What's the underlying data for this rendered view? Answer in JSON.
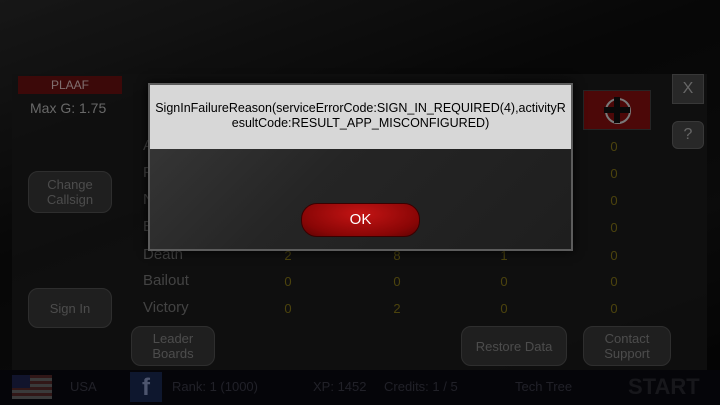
{
  "faction": "PLAAF",
  "max_g": "Max G: 1.75",
  "buttons": {
    "close": "X",
    "help": "?",
    "change_callsign": "Change Callsign",
    "sign_in": "Sign In",
    "leader_boards": "Leader Boards",
    "restore_data": "Restore Data",
    "contact_support": "Contact Support",
    "start": "START",
    "tech_tree": "Tech Tree"
  },
  "stats": {
    "partial_rows": [
      "A",
      "F",
      "N",
      "E"
    ],
    "rows": [
      {
        "label": "Death",
        "values": [
          "2",
          "8",
          "1"
        ]
      },
      {
        "label": "Bailout",
        "values": [
          "0",
          "0",
          "0"
        ]
      },
      {
        "label": "Victory",
        "values": [
          "0",
          "2",
          "0"
        ]
      }
    ],
    "right_column": [
      "0",
      "0",
      "0",
      "0",
      "0",
      "0",
      "0"
    ]
  },
  "bottom_bar": {
    "country_code": "USA",
    "rank": "Rank: 1 (1000)",
    "xp": "XP: 1452",
    "credits": "Credits: 1 / 5"
  },
  "dialog": {
    "message": "SignInFailureReason(serviceErrorCode:SIGN_IN_REQUIRED(4),activityResultCode:RESULT_APP_MISCONFIGURED)",
    "ok_label": "OK"
  },
  "colors": {
    "accent_red": "#8a0606",
    "faction_red": "#6e1111",
    "stat_value": "#8a7a18"
  }
}
